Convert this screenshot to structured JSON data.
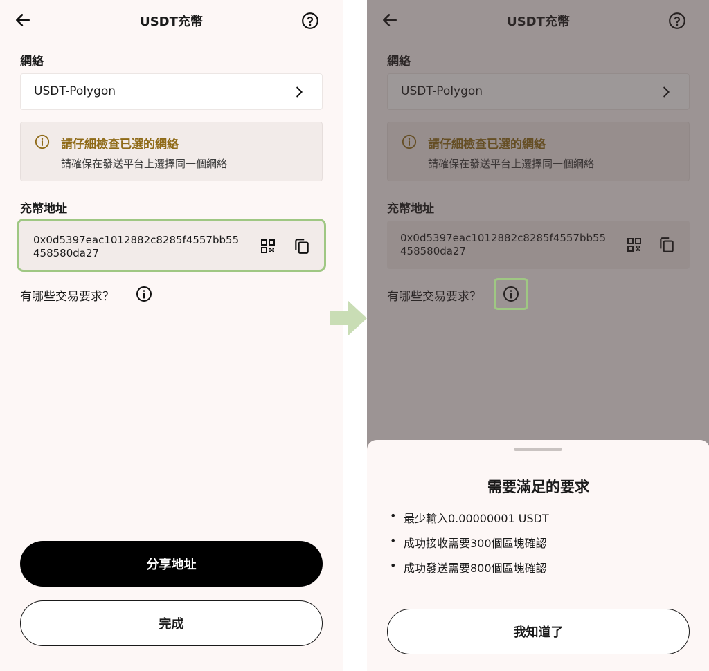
{
  "header": {
    "title": "USDT充幣"
  },
  "network": {
    "label": "網絡",
    "value": "USDT-Polygon"
  },
  "warning": {
    "title": "請仔細檢查已選的網絡",
    "description": "請確保在發送平台上選擇同一個網絡"
  },
  "address": {
    "label": "充幣地址",
    "value": "0x0d5397eac1012882c8285f4557bb55458580da27"
  },
  "requirements": {
    "question": "有哪些交易要求？"
  },
  "actions": {
    "share_label": "分享地址",
    "done_label": "完成"
  },
  "sheet": {
    "title": "需要滿足的要求",
    "items": [
      "最少輸入0.00000001 USDT",
      "成功接收需要300個區塊確認",
      "成功發送需要800個區塊確認"
    ],
    "confirm_label": "我知道了"
  },
  "colors": {
    "accent_warning": "#8f6a17",
    "highlight_green": "#9fc783",
    "primary_button": "#000000",
    "background": "#fdf7f6"
  },
  "icons": [
    "back-arrow-icon",
    "help-circle-icon",
    "chevron-right-icon",
    "info-icon",
    "qr-code-icon",
    "copy-icon",
    "arrow-right-icon"
  ]
}
